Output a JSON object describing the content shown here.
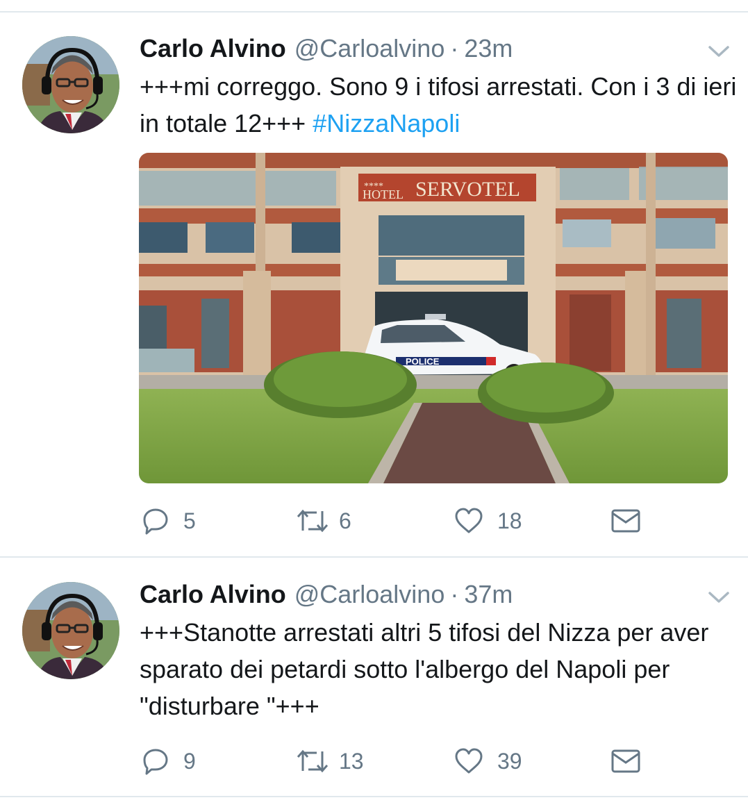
{
  "tweets": [
    {
      "author_name": "Carlo Alvino",
      "handle": "@Carloalvino",
      "separator": "·",
      "time": "23m",
      "text_before": "+++mi correggo. Sono 9 i tifosi arrestati.  Con i 3 di ieri in totale 12+++ ",
      "hashtag": "#NizzaNapoli",
      "media": {
        "hotel_sign": "SERVOTEL",
        "hotel_word": "HOTEL",
        "stars": "****",
        "car_label": "POLICE"
      },
      "replies": "5",
      "retweets": "6",
      "likes": "18"
    },
    {
      "author_name": "Carlo Alvino",
      "handle": "@Carloalvino",
      "separator": "·",
      "time": "37m",
      "text": "+++Stanotte arrestati altri 5 tifosi del Nizza per aver sparato dei petardi sotto l'albergo del Napoli per \"disturbare \"+++",
      "replies": "9",
      "retweets": "13",
      "likes": "39"
    }
  ],
  "icons": {
    "reply": "reply-icon",
    "retweet": "retweet-icon",
    "like": "heart-icon",
    "dm": "envelope-icon",
    "caret": "chevron-down-icon"
  },
  "colors": {
    "hashtag": "#1da1f2",
    "muted": "#657786",
    "divider": "#e1e8ed"
  }
}
